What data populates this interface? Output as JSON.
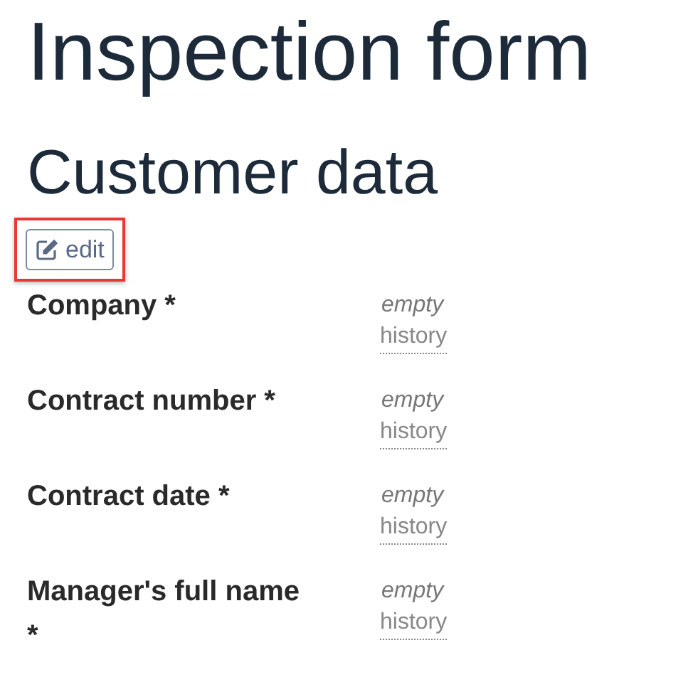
{
  "title": "Inspection form",
  "section": {
    "title": "Customer data",
    "edit_button": {
      "label": "edit",
      "highlighted": true
    },
    "fields": [
      {
        "label": "Company *",
        "value": "empty",
        "link": "history"
      },
      {
        "label": "Contract number *",
        "value": "empty",
        "link": "history"
      },
      {
        "label": "Contract date *",
        "value": "empty",
        "link": "history"
      },
      {
        "label": "Manager's full name *",
        "value": "empty",
        "link": "history"
      }
    ]
  }
}
